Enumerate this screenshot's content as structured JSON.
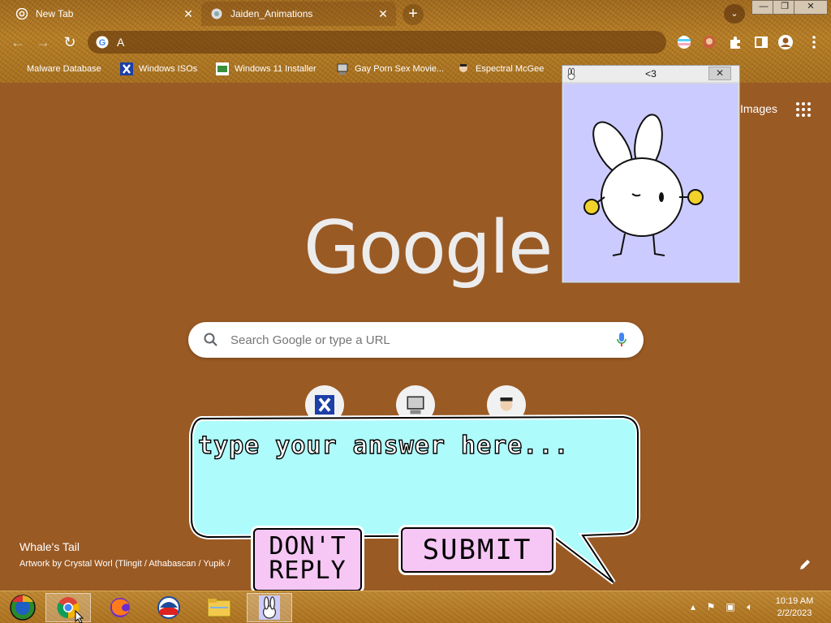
{
  "tabs": [
    {
      "title": "New Tab",
      "close": "✕"
    },
    {
      "title": "Jaiden_Animations",
      "close": "✕"
    }
  ],
  "tabstrip": {
    "new_tab": "+",
    "tab_search": "⌄"
  },
  "window_controls": {
    "minimize": "—",
    "maximize": "❐",
    "close": "✕"
  },
  "omnibox": {
    "value": "A"
  },
  "bookmarks": [
    {
      "label": "Malware Database"
    },
    {
      "label": "Windows ISOs"
    },
    {
      "label": "Windows 11 Installer"
    },
    {
      "label": "Gay Porn Sex Movie..."
    },
    {
      "label": "Espectral McGee"
    }
  ],
  "ntp": {
    "images_link": "Images",
    "logo": "Google",
    "search_placeholder": "Search Google or type a URL",
    "background_title": "Whale's Tail",
    "background_credit": "Artwork by Crystal Worl (Tlingit / Athabascan / Yupik /"
  },
  "popup": {
    "title": "<3",
    "close": "✕"
  },
  "dialog": {
    "answer_placeholder": "type your answer here...",
    "dont_reply_label": "DON'T REPLY",
    "submit_label": "SUBMIT"
  },
  "clock": {
    "time": "10:19 AM",
    "date": "2/2/2023"
  },
  "colors": {
    "theme_brown": "#9a5a24",
    "bubble_fill": "#aefbfc",
    "button_pink": "#f6c6f4",
    "popup_bg": "#cccbff"
  }
}
